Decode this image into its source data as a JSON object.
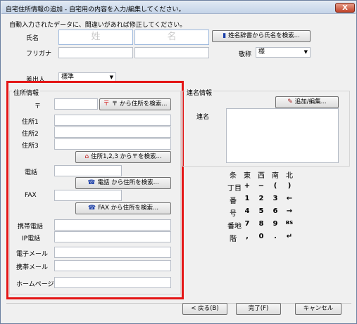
{
  "window": {
    "title": "自宅住所情報の追加 - 自宅用の内容を入力/編集してください。",
    "close_label": "X"
  },
  "instruction": "自動入力されたデータに、間違いがあれば修正してください。",
  "name": {
    "label": "氏名",
    "sei_placeholder": "姓",
    "mei_placeholder": "名",
    "search_button": "姓名辞書から氏名を検索..."
  },
  "furigana": {
    "label": "フリガナ"
  },
  "honorific": {
    "label": "敬称",
    "value": "様"
  },
  "sender": {
    "label": "差出人",
    "value": "標準"
  },
  "address": {
    "group_label": "住所情報",
    "postal_label": "〒",
    "postal_search_button": "〒 から住所を検索...",
    "addr1_label": "住所1",
    "addr2_label": "住所2",
    "addr3_label": "住所3",
    "addr_to_postal_button": "住所1,2,3 から〒を検索...",
    "phone_label": "電話",
    "phone_search_button": "電話 から住所を検索...",
    "fax_label": "FAX",
    "fax_search_button": "FAX から住所を検索...",
    "mobile_label": "携帯電話",
    "ip_phone_label": "IP電話",
    "email_label": "電子メール",
    "mobile_mail_label": "携帯メール",
    "homepage_label": "ホームページ"
  },
  "joint": {
    "group_label": "連名情報",
    "edit_button": "追加/編集...",
    "label": "連名"
  },
  "keypad": {
    "rows": [
      [
        "条",
        "東",
        "西",
        "南",
        "北"
      ],
      [
        "丁目",
        "+",
        "−",
        "(",
        ")"
      ],
      [
        "番",
        "1",
        "2",
        "3",
        "←"
      ],
      [
        "号",
        "4",
        "5",
        "6",
        "→"
      ],
      [
        "番地",
        "7",
        "8",
        "9",
        "BS"
      ],
      [
        "階",
        ",",
        "0",
        ".",
        "↵"
      ]
    ]
  },
  "footer": {
    "back_button": "< 戻る(B)",
    "finish_button": "完了(F)",
    "cancel_button": "キャンセル"
  },
  "icons": {
    "book": "book-icon",
    "postmark": "postal-mark-icon",
    "house": "house-icon",
    "phone": "phone-icon",
    "pen": "pen-icon"
  }
}
